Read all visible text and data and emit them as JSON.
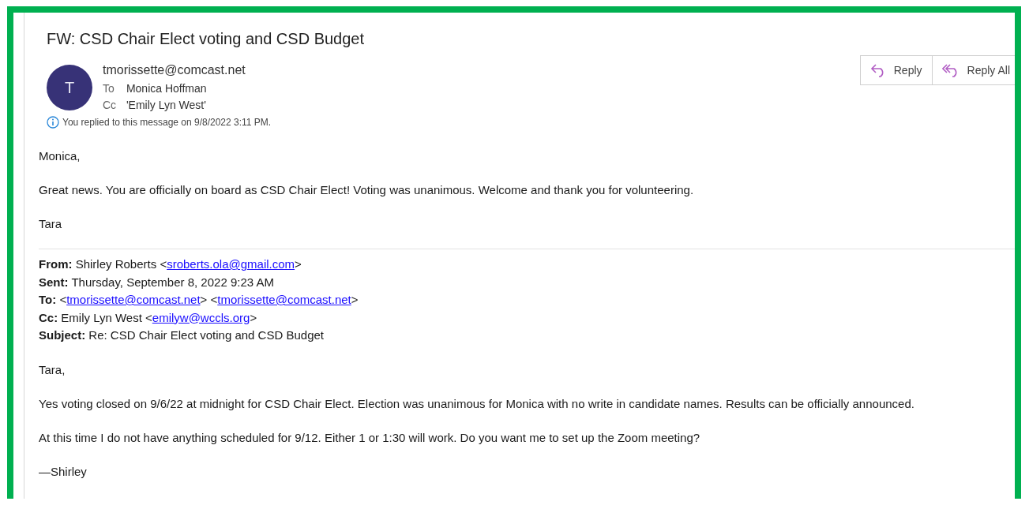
{
  "message": {
    "subject": "FW: CSD Chair Elect voting and CSD Budget",
    "avatar_initial": "T",
    "sender": "tmorissette@comcast.net",
    "recipients": [
      {
        "label": "To",
        "value": "Monica Hoffman"
      },
      {
        "label": "Cc",
        "value": "'Emily Lyn West'"
      }
    ],
    "info": "You replied to this message on 9/8/2022 3:11 PM.",
    "actions": [
      {
        "kind": "reply",
        "label": "Reply"
      },
      {
        "kind": "reply_all",
        "label": "Reply All"
      }
    ],
    "body": [
      "Monica,",
      "Great news.  You are officially on board as CSD Chair Elect!  Voting was unanimous.  Welcome and thank you for volunteering.",
      "Tara"
    ]
  },
  "forwarded": {
    "header": [
      {
        "label": "From:",
        "parts": [
          {
            "kind": "text",
            "text": "Shirley Roberts <"
          },
          {
            "kind": "link",
            "text": "sroberts.ola@gmail.com"
          },
          {
            "kind": "text",
            "text": ">"
          }
        ]
      },
      {
        "label": "Sent:",
        "parts": [
          {
            "kind": "text",
            "text": "Thursday, September 8, 2022 9:23 AM"
          }
        ]
      },
      {
        "label": "To:",
        "parts": [
          {
            "kind": "text",
            "text": "<"
          },
          {
            "kind": "link",
            "text": "tmorissette@comcast.net"
          },
          {
            "kind": "text",
            "text": "> <"
          },
          {
            "kind": "link",
            "text": "tmorissette@comcast.net"
          },
          {
            "kind": "text",
            "text": ">"
          }
        ]
      },
      {
        "label": "Cc:",
        "parts": [
          {
            "kind": "text",
            "text": "Emily Lyn West <"
          },
          {
            "kind": "link",
            "text": "emilyw@wccls.org"
          },
          {
            "kind": "text",
            "text": ">"
          }
        ]
      },
      {
        "label": "Subject:",
        "parts": [
          {
            "kind": "text",
            "text": "Re: CSD Chair Elect voting and CSD Budget"
          }
        ]
      }
    ],
    "body": [
      "Tara,",
      "Yes voting closed on 9/6/22 at midnight for CSD Chair Elect.  Election was unanimous for Monica with no write in candidate names.  Results can be officially announced.",
      "At this time I do not have anything scheduled for 9/12.  Either 1 or 1:30 will work.  Do you want me to set up the Zoom meeting?",
      "—Shirley"
    ]
  }
}
